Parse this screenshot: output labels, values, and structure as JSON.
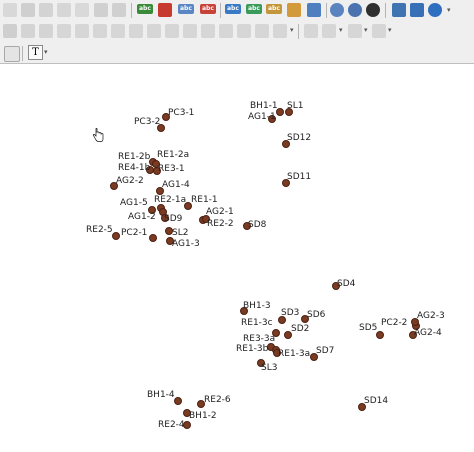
{
  "toolbar": {
    "badges": [
      "abc",
      "abc",
      "abc",
      "abc",
      "abc",
      "abc"
    ],
    "text_tool_label": "T"
  },
  "icons": [
    "new-icon",
    "save-icon",
    "cut-icon",
    "copy-icon",
    "paste-icon",
    "undo-icon",
    "redo-icon",
    "label-icon",
    "identify-icon",
    "measure-icon",
    "pin-icon",
    "move-label-icon",
    "rotate-label-icon",
    "properties-icon",
    "python-icon",
    "refresh-icon",
    "help-icon"
  ],
  "map": {
    "points": [
      {
        "label": "BH1-1"
      },
      {
        "label": "SL1"
      },
      {
        "label": "AG1-1"
      },
      {
        "label": "PC3-1"
      },
      {
        "label": "PC3-2"
      },
      {
        "label": "SD12"
      },
      {
        "label": "RE1-2b"
      },
      {
        "label": "RE1-2a"
      },
      {
        "label": "RE4-1b"
      },
      {
        "label": "RE3-1"
      },
      {
        "label": "AG2-2"
      },
      {
        "label": "SD11"
      },
      {
        "label": "AG1-4"
      },
      {
        "label": "RE2-1a"
      },
      {
        "label": "RE1-1"
      },
      {
        "label": "AG1-5"
      },
      {
        "label": "AG2-1"
      },
      {
        "label": "AG1-2"
      },
      {
        "label": "SD9"
      },
      {
        "label": "RE2-2"
      },
      {
        "label": "SD8"
      },
      {
        "label": "RE2-5"
      },
      {
        "label": "PC2-1"
      },
      {
        "label": "SL2"
      },
      {
        "label": "AG1-3"
      },
      {
        "label": "SD4"
      },
      {
        "label": "BH1-3"
      },
      {
        "label": "SD3"
      },
      {
        "label": "SD6"
      },
      {
        "label": "RE1-3c"
      },
      {
        "label": "SD2"
      },
      {
        "label": "PC2-2"
      },
      {
        "label": "AG2-3"
      },
      {
        "label": "SD5"
      },
      {
        "label": "AG2-4"
      },
      {
        "label": "RE3-3a"
      },
      {
        "label": "RE1-3b"
      },
      {
        "label": "RE1-3a"
      },
      {
        "label": "SD7"
      },
      {
        "label": "SL3"
      },
      {
        "label": "BH1-4"
      },
      {
        "label": "RE2-6"
      },
      {
        "label": "SD14"
      },
      {
        "label": "BH1-2"
      },
      {
        "label": "RE2-4"
      }
    ]
  }
}
